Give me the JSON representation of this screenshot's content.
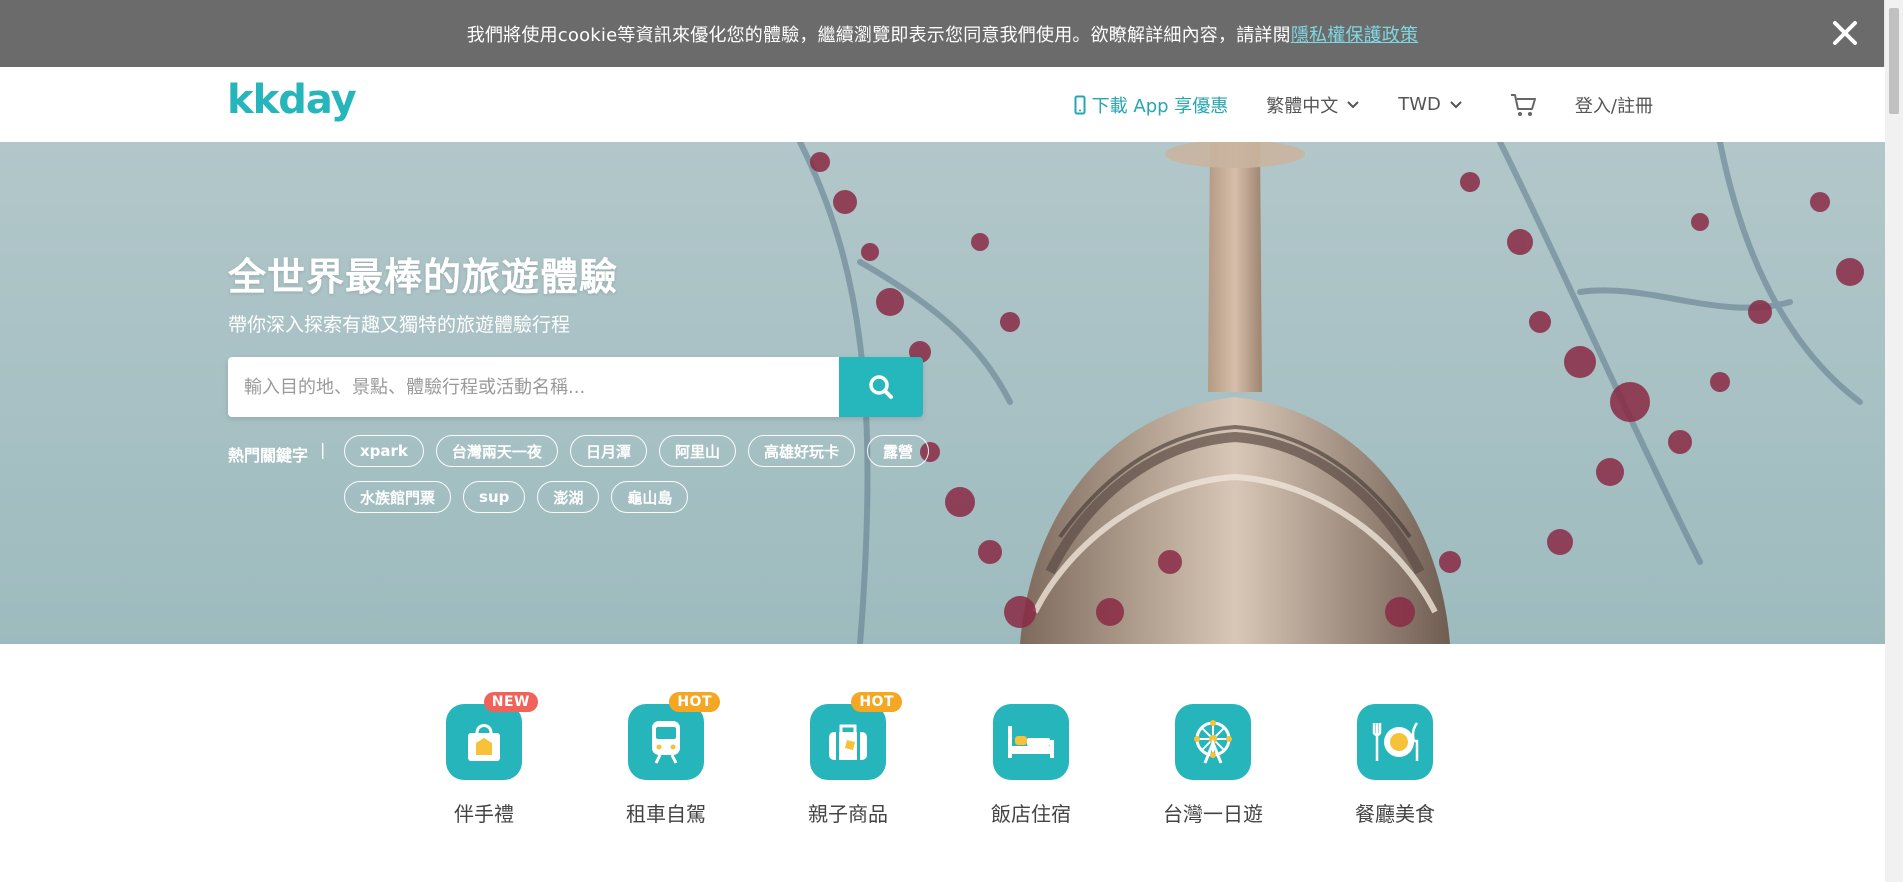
{
  "cookie_bar": {
    "message": "我們將使用cookie等資訊來優化您的體驗，繼續瀏覽即表示您同意我們使用。欲瞭解詳細內容，請詳閱",
    "link_label": "隱私權保護政策"
  },
  "header": {
    "logo_text": "kkday",
    "app_promo": "下載 App 享優惠",
    "language": "繁體中文",
    "currency": "TWD",
    "login": "登入/註冊"
  },
  "hero": {
    "title": "全世界最棒的旅遊體驗",
    "subtitle": "帶你深入探索有趣又獨特的旅遊體驗行程",
    "search_placeholder": "輸入目的地、景點、體驗行程或活動名稱...",
    "keywords_label": "熱門關鍵字",
    "keywords": [
      "xpark",
      "台灣兩天一夜",
      "日月潭",
      "阿里山",
      "高雄好玩卡",
      "露營",
      "水族館門票",
      "sup",
      "澎湖",
      "龜山島"
    ]
  },
  "categories": [
    {
      "label": "伴手禮",
      "badge": "NEW",
      "badge_color": "#f0625a",
      "icon": "gift-bag-icon"
    },
    {
      "label": "租車自駕",
      "badge": "HOT",
      "badge_color": "#f5a623",
      "icon": "train-icon"
    },
    {
      "label": "親子商品",
      "badge": "HOT",
      "badge_color": "#f5a623",
      "icon": "luggage-icon"
    },
    {
      "label": "飯店住宿",
      "badge": "",
      "badge_color": "",
      "icon": "bed-icon"
    },
    {
      "label": "台灣一日遊",
      "badge": "",
      "badge_color": "",
      "icon": "ferris-wheel-icon"
    },
    {
      "label": "餐廳美食",
      "badge": "",
      "badge_color": "",
      "icon": "dining-icon"
    }
  ],
  "colors": {
    "brand": "#26b5ba",
    "cookie_bar_bg": "#6b6b6b",
    "new_badge": "#f0625a",
    "hot_badge": "#f5a623"
  }
}
